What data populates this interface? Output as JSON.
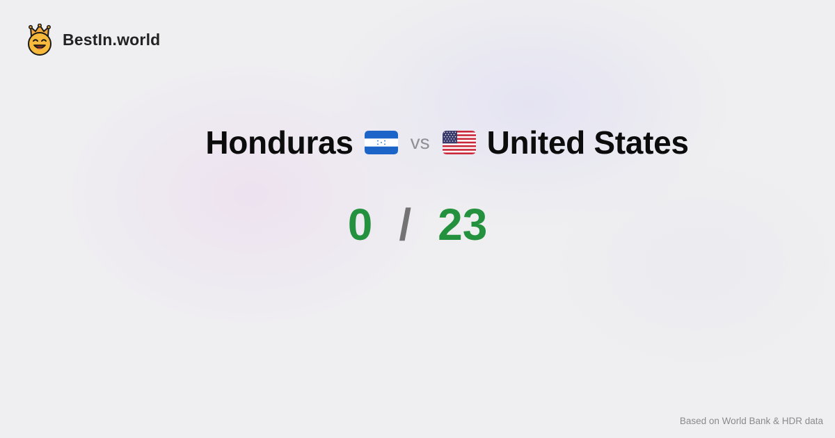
{
  "brand": {
    "name": "BestIn.world",
    "logo_icon": "crown-smiley-icon"
  },
  "comparison": {
    "left": {
      "name": "Honduras",
      "flag_icon": "honduras-flag-icon",
      "score": "0"
    },
    "vs_label": "vs",
    "right": {
      "name": "United States",
      "flag_icon": "united-states-flag-icon",
      "score": "23"
    },
    "separator": "/"
  },
  "footer": {
    "source_note": "Based on World Bank & HDR data"
  },
  "colors": {
    "score_green": "#23913e",
    "separator_gray": "#737373",
    "background": "#efeff1"
  }
}
